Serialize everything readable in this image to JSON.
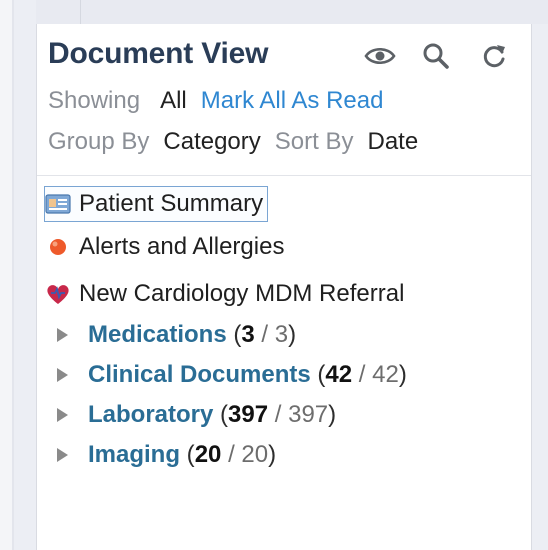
{
  "panel": {
    "title": "Document View",
    "icons": [
      "eye-icon",
      "search-icon",
      "refresh-icon"
    ],
    "showing_label": "Showing",
    "showing_value": "All",
    "mark_all_link": "Mark All As Read",
    "group_label": "Group By",
    "group_value": "Category",
    "sort_label": "Sort By",
    "sort_value": "Date"
  },
  "items": [
    {
      "label": "Patient Summary",
      "icon": "patient-summary-icon"
    },
    {
      "label": "Alerts and Allergies",
      "icon": "alert-dot-icon"
    },
    {
      "label": "New Cardiology MDM Referral",
      "icon": "heart-icon"
    }
  ],
  "categories": [
    {
      "label": "Medications",
      "unread": "3",
      "total": "3"
    },
    {
      "label": "Clinical Documents",
      "unread": "42",
      "total": "42"
    },
    {
      "label": "Laboratory",
      "unread": "397",
      "total": "397"
    },
    {
      "label": "Imaging",
      "unread": "20",
      "total": "20"
    }
  ],
  "colors": {
    "title": "#2a3d57",
    "link": "#2f87d1",
    "category": "#2a6d95",
    "alert": "#ee5a2b",
    "heart": "#c8284a"
  }
}
